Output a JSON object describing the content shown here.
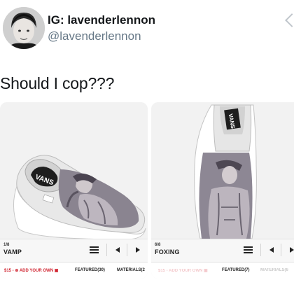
{
  "profile": {
    "display_name": "IG: lavenderlennon",
    "handle": "@lavenderlennon"
  },
  "tweet": {
    "text": "Should I cop???"
  },
  "panels": [
    {
      "step": "1/8",
      "part": "VAMP",
      "price": "$15 - ⊕ ADD YOUR OWN ▣",
      "featured": "FEATURED(30)",
      "materials": "MATERIALS(2"
    },
    {
      "step": "6/8",
      "part": "FOXING",
      "price": "$15 - ADD YOUR OWN ▣",
      "featured": "FEATURED(7)",
      "materials": "MATERIALS(6"
    }
  ],
  "brand_mark": "VANS",
  "colors": {
    "accent_red": "#d0232f",
    "handle_gray": "#657786",
    "panel_bg": "#efefef"
  },
  "icons": [
    "avatar-photo",
    "hamburger-menu-icon",
    "prev-arrow-icon",
    "next-arrow-icon",
    "camera-icon",
    "plus-circle-icon",
    "share-arrow-icon"
  ]
}
